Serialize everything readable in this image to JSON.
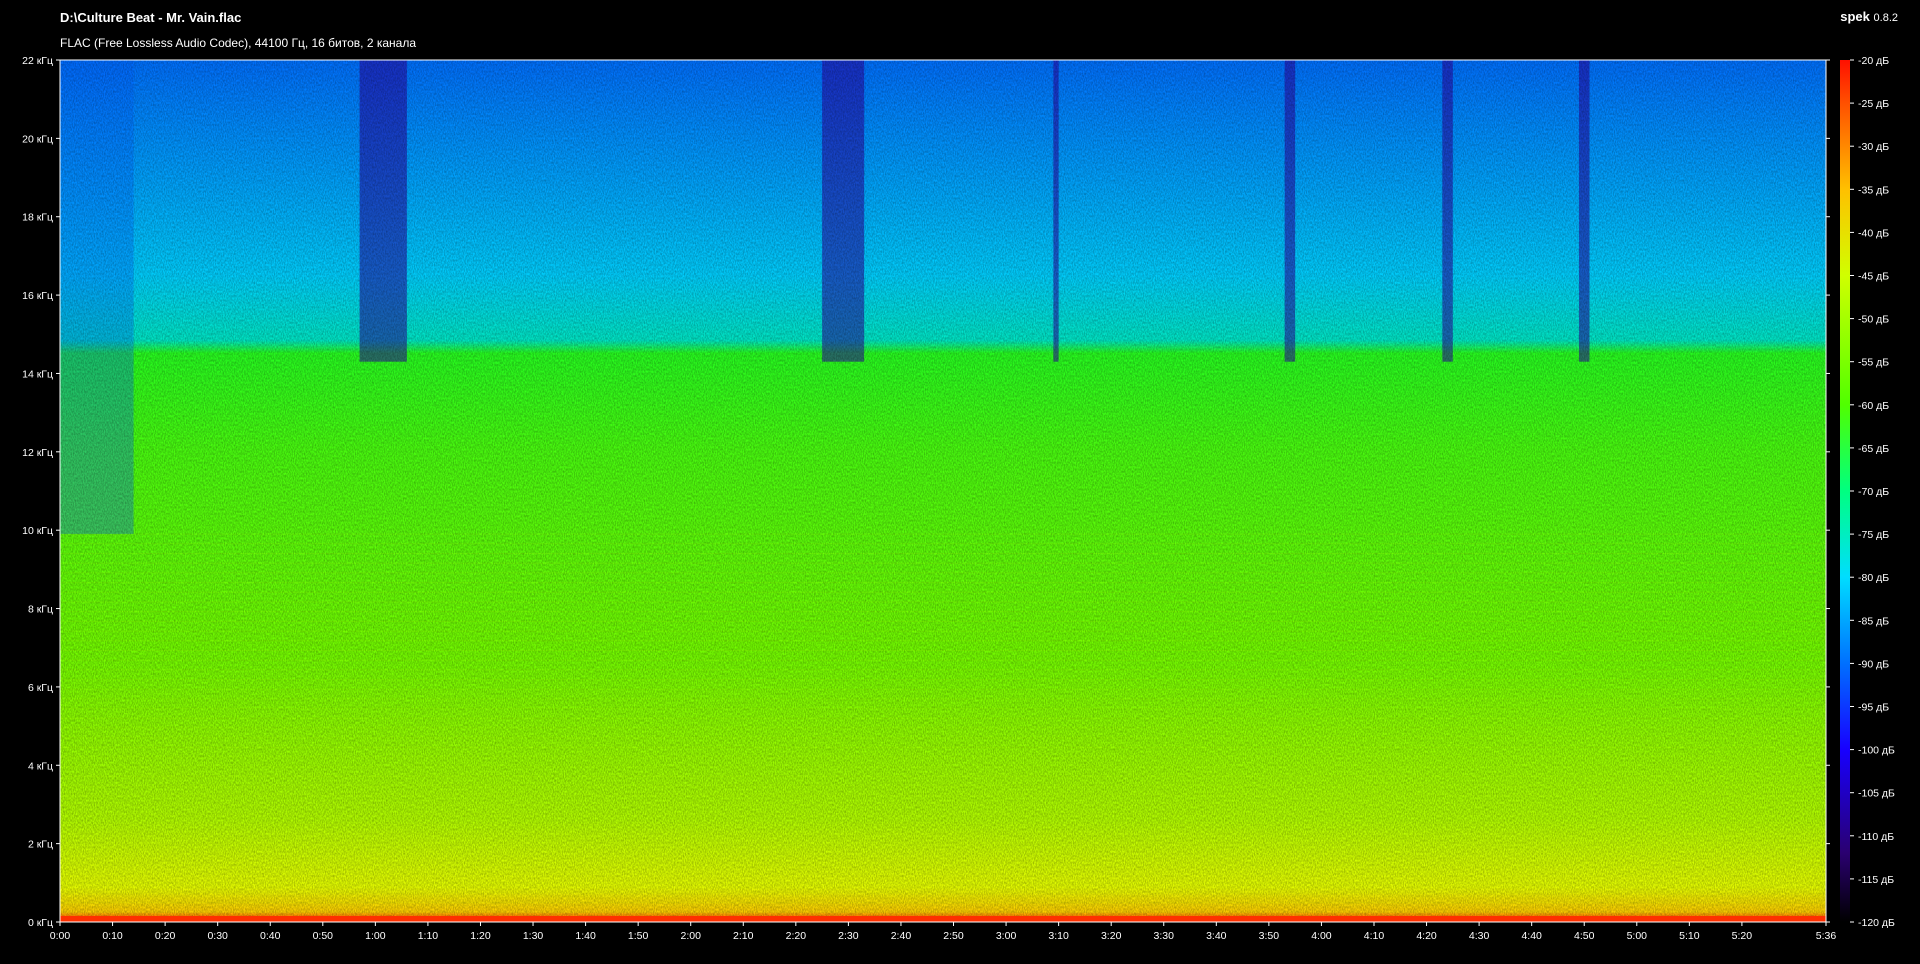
{
  "header": {
    "file_title": "D:\\Culture Beat - Mr. Vain.flac",
    "file_info": "FLAC (Free Lossless Audio Codec), 44100 Гц, 16 битов, 2 канала",
    "app_name": "spek",
    "app_version": "0.8.2"
  },
  "chart_data": {
    "type": "heatmap",
    "x_ticks": [
      "0:00",
      "0:10",
      "0:20",
      "0:30",
      "0:40",
      "0:50",
      "1:00",
      "1:10",
      "1:20",
      "1:30",
      "1:40",
      "1:50",
      "2:00",
      "2:10",
      "2:20",
      "2:30",
      "2:40",
      "2:50",
      "3:00",
      "3:10",
      "3:20",
      "3:30",
      "3:40",
      "3:50",
      "4:00",
      "4:10",
      "4:20",
      "4:30",
      "4:40",
      "4:50",
      "5:00",
      "5:10",
      "5:20"
    ],
    "x_end_label": "5:36",
    "x_range_seconds": [
      0,
      336
    ],
    "y_ticks": [
      "0 кГц",
      "2 кГц",
      "4 кГц",
      "6 кГц",
      "8 кГц",
      "10 кГц",
      "12 кГц",
      "14 кГц",
      "16 кГц",
      "18 кГц",
      "20 кГц",
      "22 кГц"
    ],
    "y_range_khz": [
      0,
      22
    ],
    "colorbar_ticks": [
      "-20 дБ",
      "-25 дБ",
      "-30 дБ",
      "-35 дБ",
      "-40 дБ",
      "-45 дБ",
      "-50 дБ",
      "-55 дБ",
      "-60 дБ",
      "-65 дБ",
      "-70 дБ",
      "-75 дБ",
      "-80 дБ",
      "-85 дБ",
      "-90 дБ",
      "-95 дБ",
      "-100 дБ",
      "-105 дБ",
      "-110 дБ",
      "-115 дБ",
      "-120 дБ"
    ],
    "colorbar_range_db": [
      -120,
      -20
    ],
    "colormap": [
      "#000000",
      "#1a0030",
      "#3a00a0",
      "#0010ff",
      "#0080ff",
      "#00e0ff",
      "#00ff90",
      "#40ff00",
      "#a0ff00",
      "#ffff00",
      "#ffa000",
      "#ff2000"
    ],
    "low_level_sections_seconds": [
      [
        57,
        66
      ],
      [
        145,
        153
      ],
      [
        189,
        190
      ],
      [
        233,
        235
      ],
      [
        263,
        265
      ],
      [
        289,
        291
      ]
    ]
  }
}
